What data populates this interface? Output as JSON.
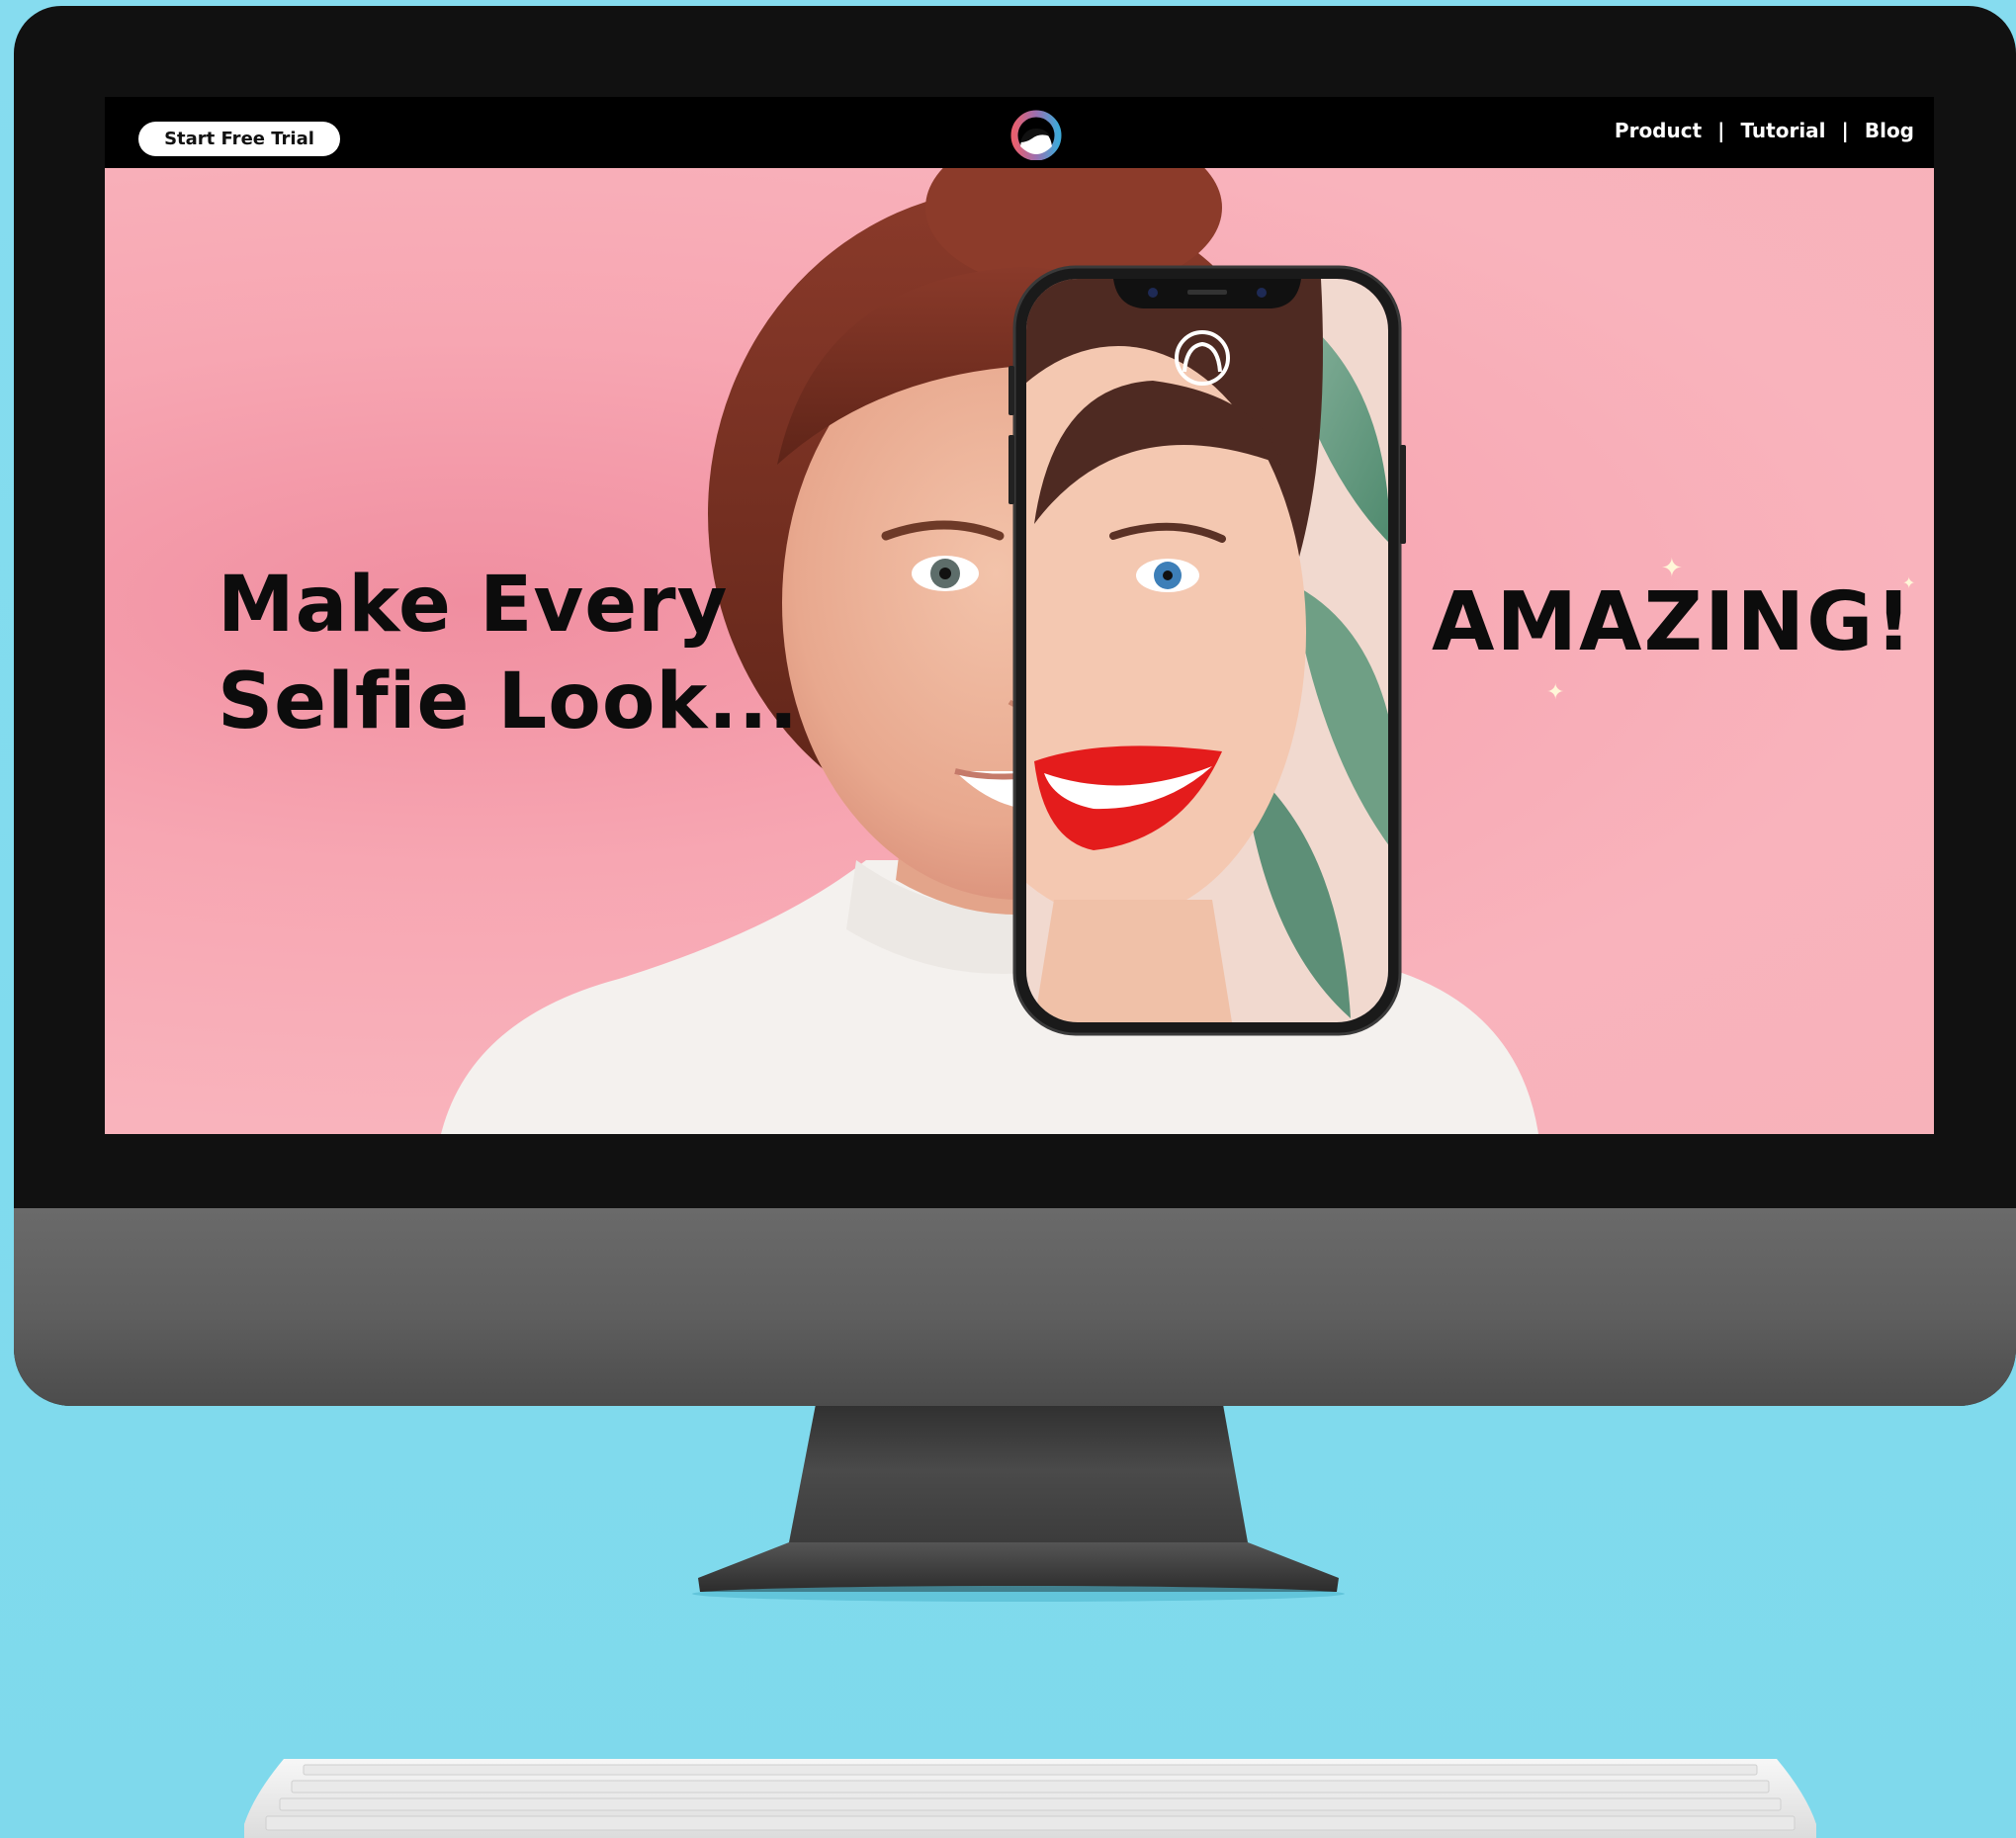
{
  "nav": {
    "cta_label": "Start Free Trial",
    "links": [
      "Product",
      "Tutorial",
      "Blog"
    ],
    "separator": "|"
  },
  "hero": {
    "headline_line1": "Make Every",
    "headline_line2": "Selfie Look...",
    "tagline": "AMAZING!"
  },
  "icons": {
    "logo": "face-logo-icon",
    "phone_app_icon": "face-outline-icon",
    "sparkle": "sparkle-icon"
  },
  "colors": {
    "background": "#84dbee",
    "hero_pink": "#f7a9b5",
    "text": "#0c0c0c",
    "logo_blue": "#3fa9d8",
    "logo_pink": "#e8606f"
  }
}
